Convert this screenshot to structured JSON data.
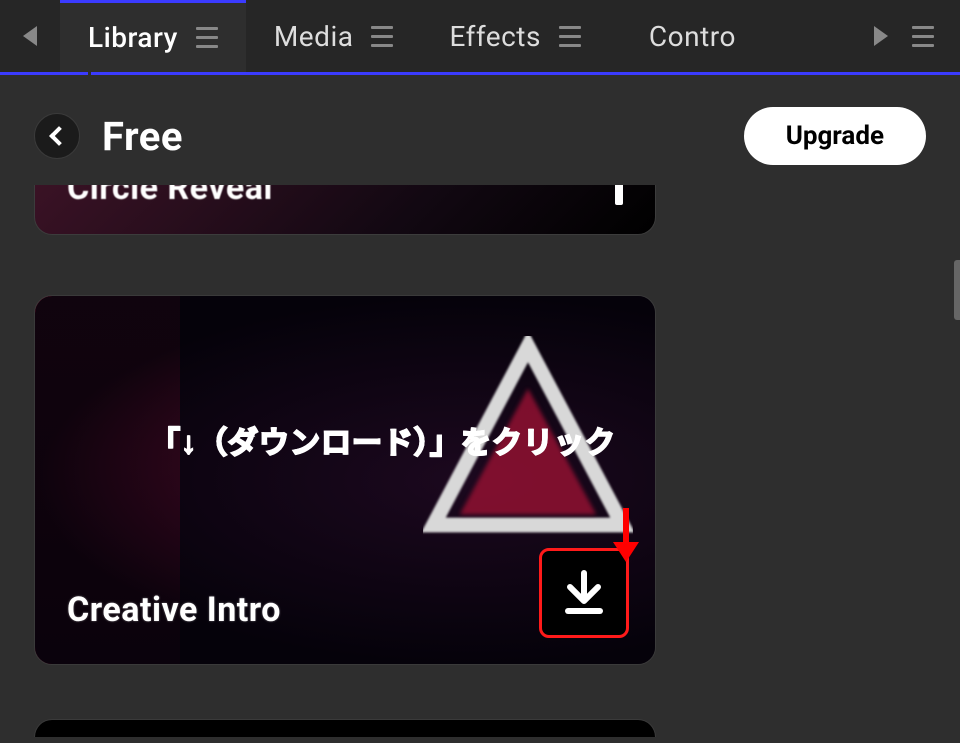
{
  "tabs": {
    "items": [
      {
        "label": "Library",
        "active": true
      },
      {
        "label": "Media",
        "active": false
      },
      {
        "label": "Effects",
        "active": false
      },
      {
        "label": "Contro",
        "active": false
      }
    ]
  },
  "header": {
    "title": "Free",
    "upgrade_label": "Upgrade"
  },
  "library": {
    "prev_card_title": "Circle Reveal",
    "current_card_title": "Creative Intro"
  },
  "annotation": {
    "text": "「↓（ダウンロード）」をクリック"
  }
}
